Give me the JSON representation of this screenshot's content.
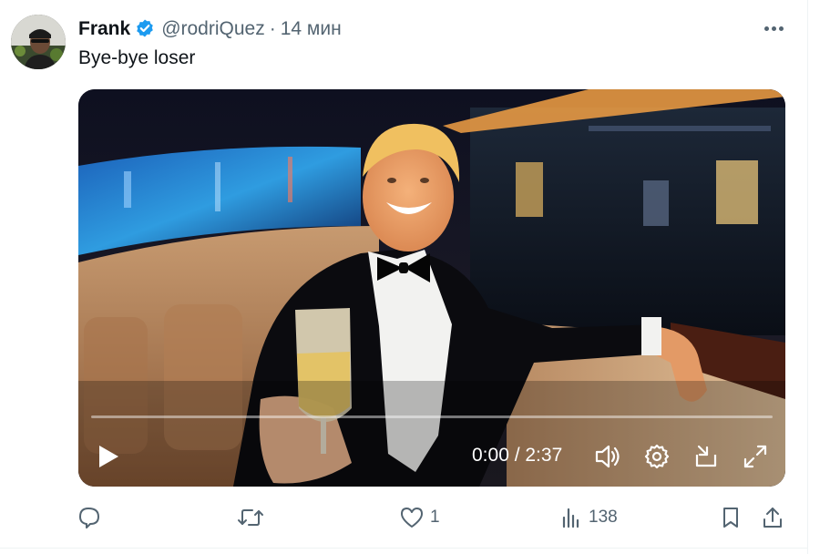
{
  "tweet": {
    "author_name": "Frank",
    "author_handle": "@rodriQuez",
    "separator": "·",
    "time_ago": "14 мин",
    "text": "Bye-bye loser"
  },
  "video": {
    "timecode": "0:00 / 2:37",
    "progress_fraction": 0.0
  },
  "actions": {
    "reply_count": "",
    "retweet_count": "",
    "like_count": "1",
    "views_count": "138"
  },
  "colors": {
    "text_primary": "#0f1419",
    "text_secondary": "#536471",
    "verified_blue": "#1d9bf0",
    "divider": "#eff3f4"
  },
  "icons": [
    "verified-badge-icon",
    "more-dots-icon",
    "play-icon",
    "volume-icon",
    "settings-gear-icon",
    "popout-icon",
    "fullscreen-icon",
    "reply-icon",
    "retweet-icon",
    "like-heart-icon",
    "views-chart-icon",
    "bookmark-icon",
    "share-icon"
  ]
}
